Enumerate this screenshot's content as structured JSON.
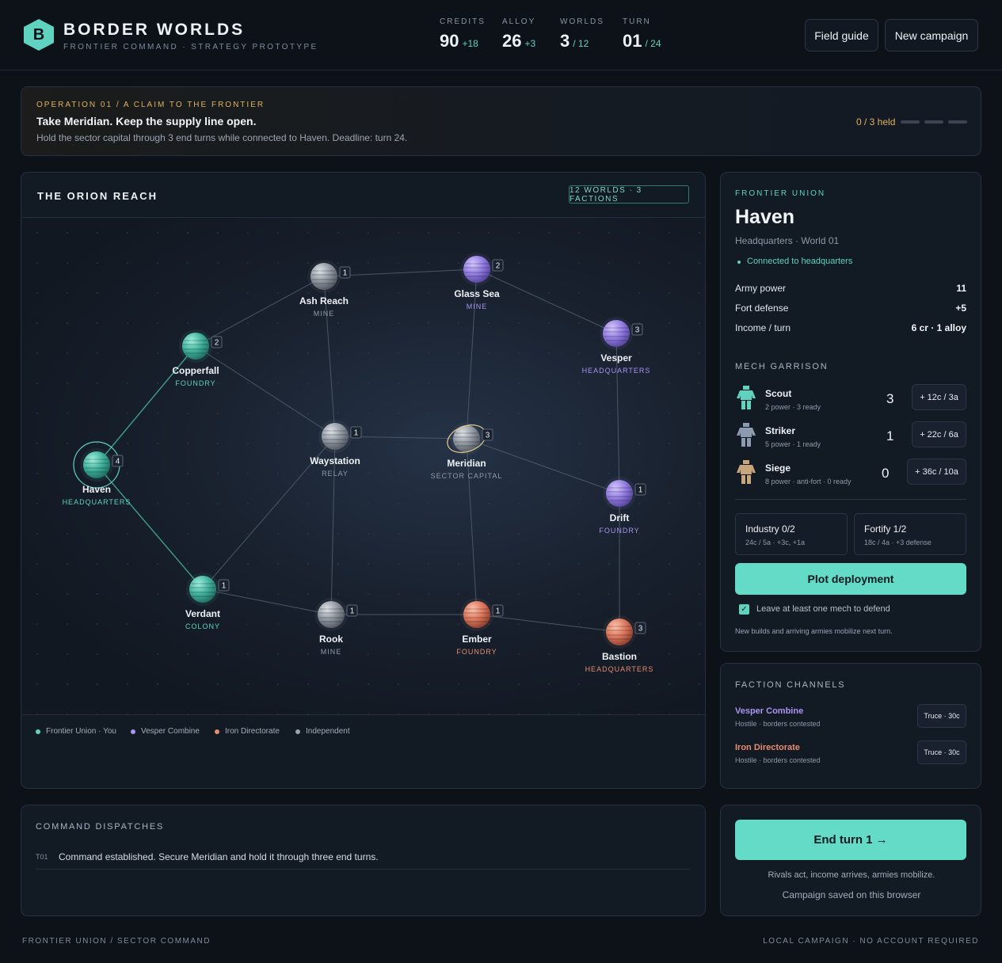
{
  "app": {
    "logo_letter": "B",
    "title": "BORDER WORLDS",
    "subtitle": "FRONTIER COMMAND · STRATEGY PROTOTYPE"
  },
  "stats": {
    "credits": {
      "label": "CREDITS",
      "value": "90",
      "delta": "+18"
    },
    "alloy": {
      "label": "ALLOY",
      "value": "26",
      "delta": "+3"
    },
    "worlds": {
      "label": "WORLDS",
      "value": "3",
      "of": "/ 12"
    },
    "turn": {
      "label": "TURN",
      "value": "01",
      "of": "/ 24"
    }
  },
  "header_buttons": {
    "field_guide": "Field guide",
    "new_campaign": "New campaign"
  },
  "operation": {
    "kicker": "OPERATION 01 / A CLAIM TO THE FRONTIER",
    "title": "Take Meridian. Keep the supply line open.",
    "description": "Hold the sector capital through 3 end turns while connected to Haven. Deadline: turn 24.",
    "held": "0 / 3 held",
    "held_value": 0,
    "held_total": 3
  },
  "map": {
    "title": "THE ORION REACH",
    "badge": "12 WORLDS · 3 FACTIONS",
    "selected": "Haven",
    "worlds": [
      {
        "name": "Ash Reach",
        "role": "MINE",
        "garrison": "1",
        "faction": "independent"
      },
      {
        "name": "Glass Sea",
        "role": "MINE",
        "garrison": "2",
        "faction": "vesper"
      },
      {
        "name": "Copperfall",
        "role": "FOUNDRY",
        "garrison": "2",
        "faction": "union"
      },
      {
        "name": "Vesper",
        "role": "HEADQUARTERS",
        "garrison": "3",
        "faction": "vesper"
      },
      {
        "name": "Waystation",
        "role": "RELAY",
        "garrison": "1",
        "faction": "independent"
      },
      {
        "name": "Meridian",
        "role": "SECTOR CAPITAL",
        "garrison": "3",
        "faction": "independent"
      },
      {
        "name": "Haven",
        "role": "HEADQUARTERS",
        "garrison": "4",
        "faction": "union"
      },
      {
        "name": "Drift",
        "role": "FOUNDRY",
        "garrison": "1",
        "faction": "vesper"
      },
      {
        "name": "Verdant",
        "role": "COLONY",
        "garrison": "1",
        "faction": "union"
      },
      {
        "name": "Rook",
        "role": "MINE",
        "garrison": "1",
        "faction": "independent"
      },
      {
        "name": "Ember",
        "role": "FOUNDRY",
        "garrison": "1",
        "faction": "iron"
      },
      {
        "name": "Bastion",
        "role": "HEADQUARTERS",
        "garrison": "3",
        "faction": "iron"
      }
    ],
    "lanes": [
      [
        "Haven",
        "Copperfall"
      ],
      [
        "Haven",
        "Verdant"
      ],
      [
        "Copperfall",
        "Ash Reach"
      ],
      [
        "Copperfall",
        "Waystation"
      ],
      [
        "Ash Reach",
        "Glass Sea"
      ],
      [
        "Ash Reach",
        "Waystation"
      ],
      [
        "Glass Sea",
        "Vesper"
      ],
      [
        "Glass Sea",
        "Meridian"
      ],
      [
        "Vesper",
        "Drift"
      ],
      [
        "Waystation",
        "Meridian"
      ],
      [
        "Waystation",
        "Verdant"
      ],
      [
        "Waystation",
        "Rook"
      ],
      [
        "Meridian",
        "Drift"
      ],
      [
        "Meridian",
        "Ember"
      ],
      [
        "Drift",
        "Bastion"
      ],
      [
        "Verdant",
        "Rook"
      ],
      [
        "Rook",
        "Ember"
      ],
      [
        "Ember",
        "Bastion"
      ]
    ],
    "legend": [
      {
        "label": "Frontier Union · You",
        "color": "#5fd3bf"
      },
      {
        "label": "Vesper Combine",
        "color": "#a895f2"
      },
      {
        "label": "Iron Directorate",
        "color": "#e88c70"
      },
      {
        "label": "Independent",
        "color": "#9aa3ad"
      }
    ]
  },
  "faction_colors": {
    "union": "#5fd3bf",
    "vesper": "#a895f2",
    "iron": "#e88c70",
    "independent": "#9aa3ad"
  },
  "world_panel": {
    "kicker": "FRONTIER UNION",
    "name": "Haven",
    "subtitle": "Headquarters · World 01",
    "status": "Connected to headquarters",
    "stats": [
      {
        "label": "Army power",
        "value": "11"
      },
      {
        "label": "Fort defense",
        "value": "+5"
      },
      {
        "label": "Income / turn",
        "value": "6 cr · 1 alloy"
      }
    ],
    "garrison_title": "MECH GARRISON",
    "mechs": [
      {
        "name": "Scout",
        "sub": "2 power · 3 ready",
        "count": "3",
        "cost": "+ 12c / 3a",
        "color": "#5fd3bf"
      },
      {
        "name": "Striker",
        "sub": "5 power · 1 ready",
        "count": "1",
        "cost": "+ 22c / 6a",
        "color": "#8d9bb0"
      },
      {
        "name": "Siege",
        "sub": "8 power · anti-fort · 0 ready",
        "count": "0",
        "cost": "+ 36c / 10a",
        "color": "#c9a57c"
      }
    ],
    "industry": {
      "title": "Industry 0/2",
      "sub": "24c / 5a · +3c, +1a"
    },
    "fortify": {
      "title": "Fortify 1/2",
      "sub": "18c / 4a · +3 defense"
    },
    "deploy_label": "Plot deployment",
    "leave_defender": "Leave at least one mech to defend",
    "leave_defender_checked": true,
    "note": "New builds and arriving armies mobilize next turn."
  },
  "channels": {
    "title": "FACTION CHANNELS",
    "items": [
      {
        "name": "Vesper Combine",
        "sub": "Hostile · borders contested",
        "action": "Truce · 30c",
        "color": "#a895f2"
      },
      {
        "name": "Iron Directorate",
        "sub": "Hostile · borders contested",
        "action": "Truce · 30c",
        "color": "#e88c70"
      }
    ]
  },
  "dispatches": {
    "title": "COMMAND DISPATCHES",
    "items": [
      {
        "turn": "T01",
        "text": "Command established. Secure Meridian and hold it through three end turns."
      }
    ]
  },
  "end_turn": {
    "label": "End turn 1 →",
    "note1": "Rivals act, income arrives, armies mobilize.",
    "note2": "Campaign saved on this browser"
  },
  "footer": {
    "left": "FRONTIER UNION / SECTOR COMMAND",
    "right": "LOCAL CAMPAIGN · NO ACCOUNT REQUIRED"
  }
}
